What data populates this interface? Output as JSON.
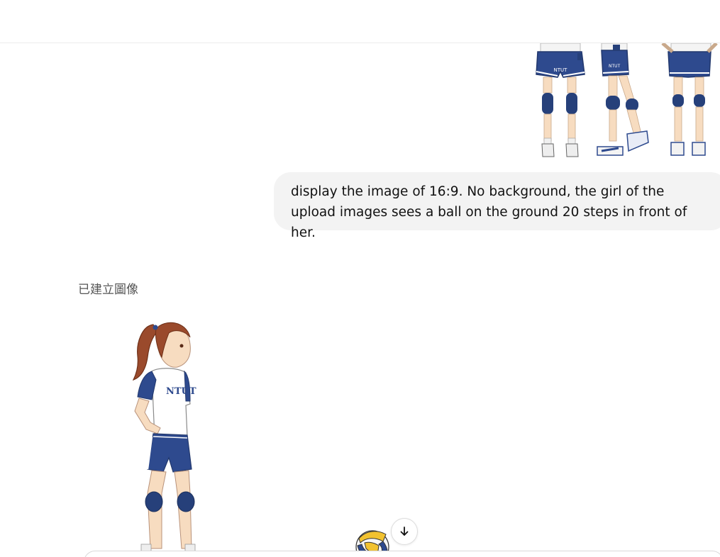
{
  "conversation": {
    "user_message": {
      "text": "display the image of 16:9. No background, the girl of the upload images sees a ball on the ground 20 steps in front of her."
    },
    "assistant_message": {
      "status_label": "已建立圖像"
    }
  },
  "images": {
    "uploaded_reference": {
      "jersey_text": "NTUT"
    },
    "generated": {
      "jersey_text": "NTUT"
    }
  },
  "controls": {
    "scroll_down_icon": "arrow-down-icon",
    "composer_icon": "text-input-icon"
  },
  "colors": {
    "uniform_navy": "#2e4a8e",
    "bubble_bg": "#f3f3f3",
    "ball_yellow": "#f2c230",
    "hair_brown": "#9a4a2c"
  }
}
